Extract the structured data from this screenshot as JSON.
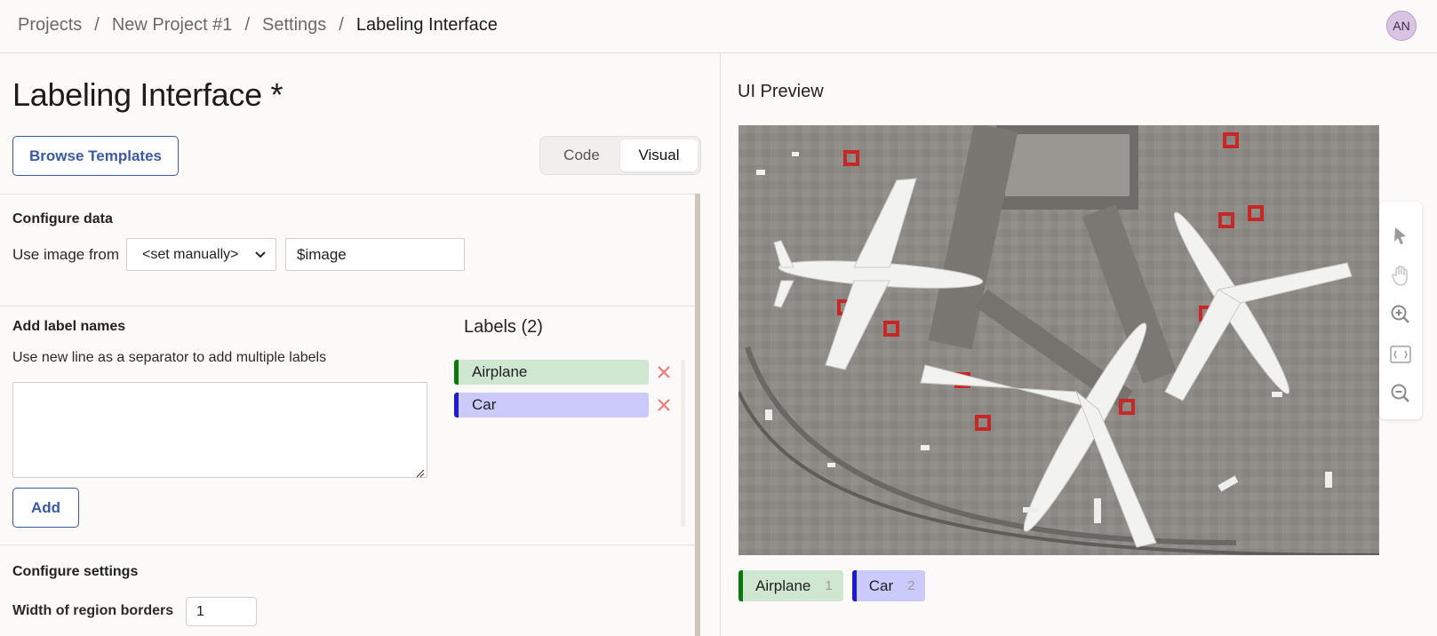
{
  "breadcrumb": {
    "items": [
      "Projects",
      "New Project #1",
      "Settings"
    ],
    "current": "Labeling Interface",
    "separator": "/"
  },
  "user": {
    "initials": "AN"
  },
  "page": {
    "title": "Labeling Interface *"
  },
  "toolbar": {
    "browse_label": "Browse Templates",
    "mode_options": [
      "Code",
      "Visual"
    ],
    "mode_selected": "Visual"
  },
  "configure_data": {
    "title": "Configure data",
    "use_image_label": "Use image from",
    "source_select": "<set manually>",
    "value": "$image"
  },
  "add_labels": {
    "title": "Add label names",
    "hint": "Use new line as a separator to add multiple labels",
    "textarea_value": "",
    "add_label": "Add"
  },
  "labels_panel": {
    "title": "Labels (2)",
    "items": [
      {
        "name": "Airplane",
        "color": "#0b7a0b",
        "bg": "#cfe6d0"
      },
      {
        "name": "Car",
        "color": "#1d1ad6",
        "bg": "#cccafa"
      }
    ]
  },
  "settings": {
    "title": "Configure settings",
    "border_width_label": "Width of region borders",
    "border_width_value": "1"
  },
  "preview": {
    "title": "UI Preview",
    "tools": [
      "pointer-icon",
      "hand-icon",
      "zoom-in-icon",
      "fit-icon",
      "zoom-out-icon"
    ],
    "chips": [
      {
        "name": "Airplane",
        "hotkey": "1"
      },
      {
        "name": "Car",
        "hotkey": "2"
      }
    ]
  }
}
